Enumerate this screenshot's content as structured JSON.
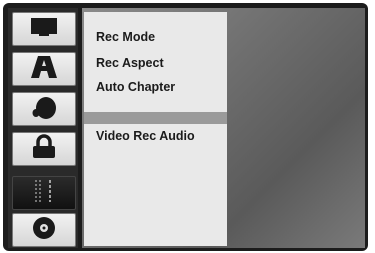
{
  "menu": {
    "items": [
      {
        "label": "Rec Mode"
      },
      {
        "label": "Rec Aspect"
      },
      {
        "label": "Auto Chapter"
      },
      {
        "label": "Video Rec Audio"
      }
    ]
  },
  "sidebar": {
    "icons": [
      {
        "name": "tv-icon",
        "selected": false
      },
      {
        "name": "language-icon",
        "selected": false
      },
      {
        "name": "audio-icon",
        "selected": false
      },
      {
        "name": "lock-icon",
        "selected": false
      },
      {
        "name": "recording-icon",
        "selected": true
      },
      {
        "name": "disc-icon",
        "selected": false
      }
    ]
  },
  "colors": {
    "frame": "#1c1c1c",
    "menu_background": "#e9e9e9",
    "text": "#1b1b1b"
  }
}
